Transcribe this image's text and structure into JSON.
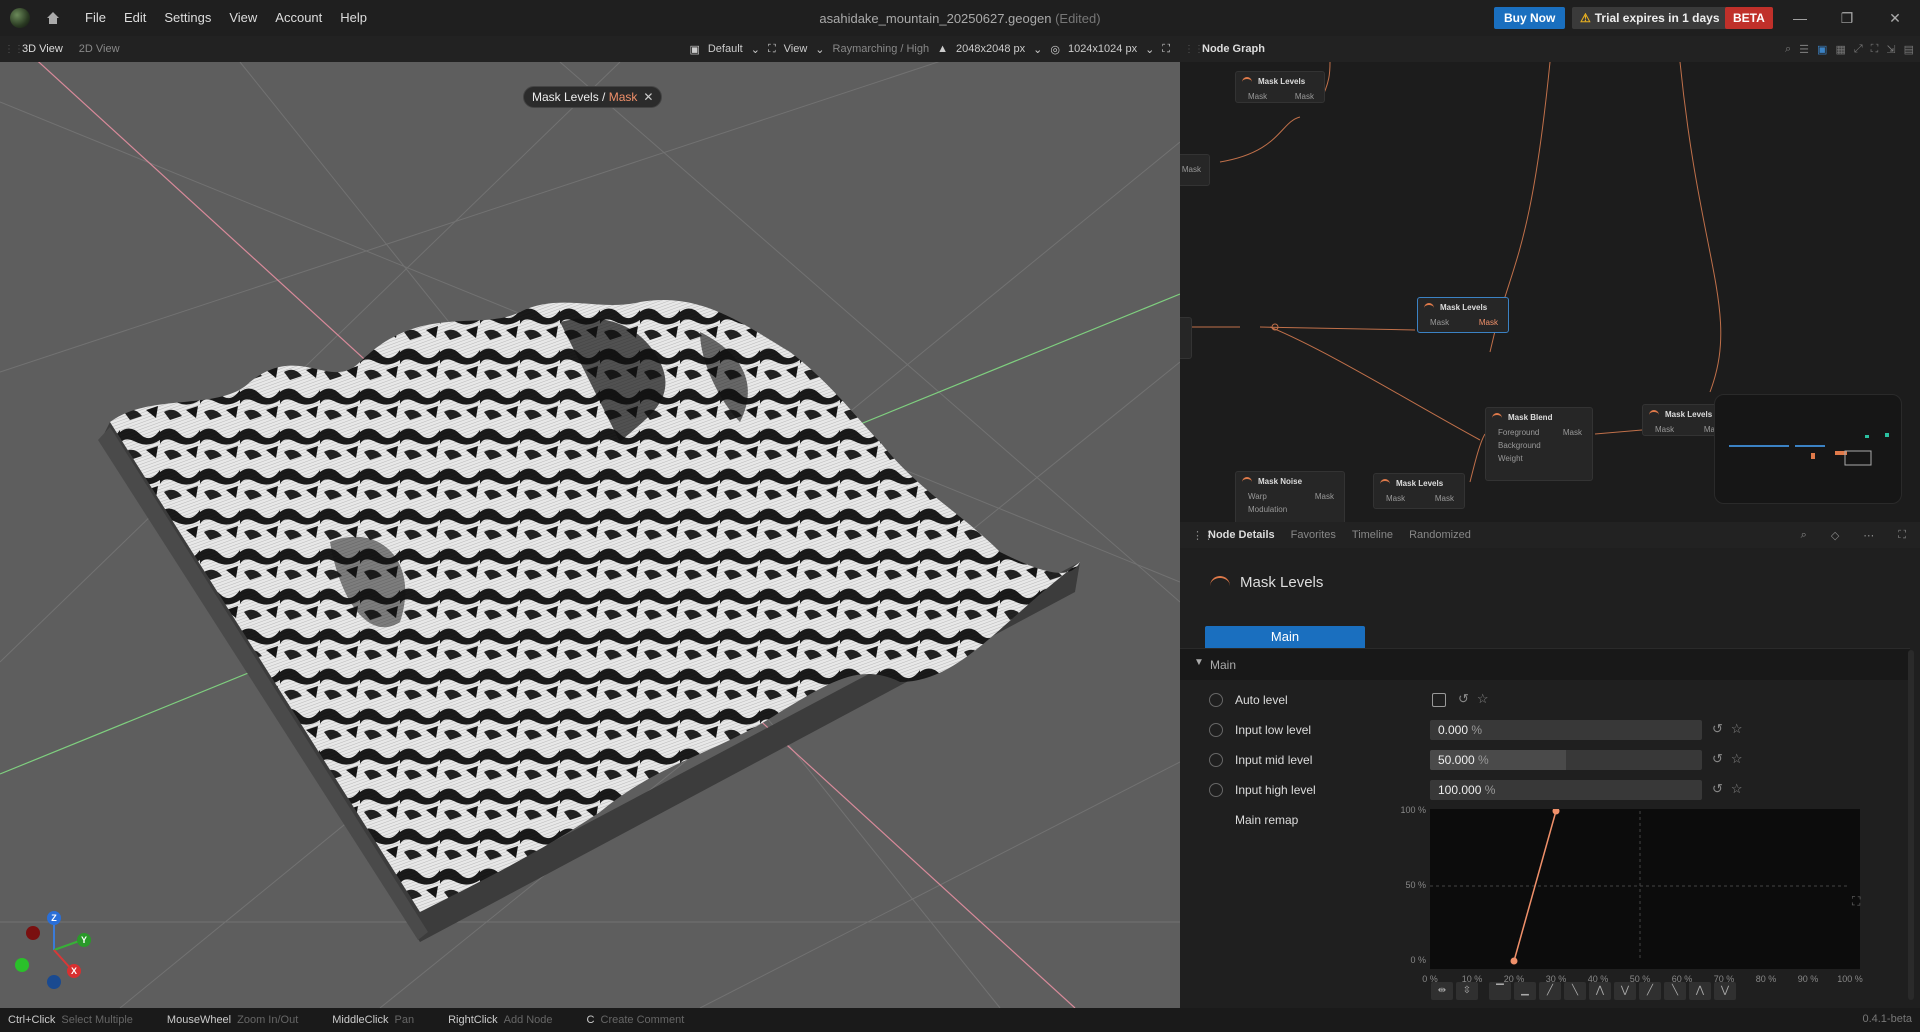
{
  "menu": [
    "File",
    "Edit",
    "Settings",
    "View",
    "Account",
    "Help"
  ],
  "document": {
    "name": "asahidake_mountain_20250627.geogen",
    "state": "(Edited)"
  },
  "buy_now": "Buy Now",
  "trial": "Trial expires in 1 days",
  "beta": "BETA",
  "viewport_tabs": [
    "3D View",
    "2D View"
  ],
  "viewport_toolbar": {
    "camera": "Default",
    "view": "View",
    "render": "Raymarching / High",
    "resolution": "2048x2048 px",
    "preview_res": "1024x1024 px"
  },
  "breadcrumb": {
    "node": "Mask Levels",
    "sep": " / ",
    "output": "Mask"
  },
  "gizmo": {
    "z": "Z",
    "y": "Y",
    "x": "X"
  },
  "node_graph": {
    "title": "Node Graph",
    "nodes": [
      {
        "title": "Mask Levels",
        "ports": [
          [
            "Mask",
            "Mask"
          ]
        ]
      },
      {
        "title": "Mask Levels",
        "ports": [
          [
            "Mask",
            "Mask"
          ]
        ]
      },
      {
        "title": "Mask Blend",
        "ports": [
          [
            "Foreground",
            "Mask"
          ],
          [
            "Background",
            ""
          ],
          [
            "Weight",
            ""
          ]
        ]
      },
      {
        "title": "Mask Levels",
        "ports": [
          [
            "Mask",
            "Mas"
          ]
        ]
      },
      {
        "title": "Mask Noise",
        "ports": [
          [
            "Warp",
            "Mask"
          ],
          [
            "Modulation",
            ""
          ]
        ]
      },
      {
        "title": "Mask Levels",
        "ports": [
          [
            "Mask",
            "Mask"
          ]
        ]
      }
    ],
    "fragment": {
      "label": "Mask"
    }
  },
  "details_tabs": [
    "Node Details",
    "Favorites",
    "Timeline",
    "Randomized"
  ],
  "details": {
    "node_title": "Mask Levels",
    "main_tab": "Main",
    "section": "Main",
    "params": [
      {
        "name": "Auto level"
      },
      {
        "name": "Input low level",
        "value": "0.000",
        "unit": "%",
        "fraction": 0.0
      },
      {
        "name": "Input mid level",
        "value": "50.000",
        "unit": "%",
        "fraction": 0.5
      },
      {
        "name": "Input high level",
        "value": "100.000",
        "unit": "%",
        "fraction": 1.0
      }
    ],
    "remap_label": "Main remap"
  },
  "chart_data": {
    "type": "line",
    "title": "",
    "x": [
      20,
      30
    ],
    "y": [
      0,
      100
    ],
    "xticks": [
      "0 %",
      "10 %",
      "20 %",
      "30 %",
      "40 %",
      "50 %",
      "60 %",
      "70 %",
      "80 %",
      "90 %",
      "100 %"
    ],
    "yticks": [
      "100 %",
      "50 %",
      "0 %"
    ],
    "xlim": [
      0,
      100
    ],
    "ylim": [
      0,
      100
    ],
    "color": "#f0906a"
  },
  "status": [
    {
      "key": "Ctrl+Click",
      "action": "Select Multiple"
    },
    {
      "key": "MouseWheel",
      "action": "Zoom In/Out"
    },
    {
      "key": "MiddleClick",
      "action": "Pan"
    },
    {
      "key": "RightClick",
      "action": "Add Node"
    },
    {
      "key": "C",
      "action": "Create Comment"
    }
  ],
  "version": "0.4.1-beta",
  "colors": {
    "accent": "#1a6fbf",
    "node_accent": "#e07a4a",
    "beta": "#c0302a"
  }
}
